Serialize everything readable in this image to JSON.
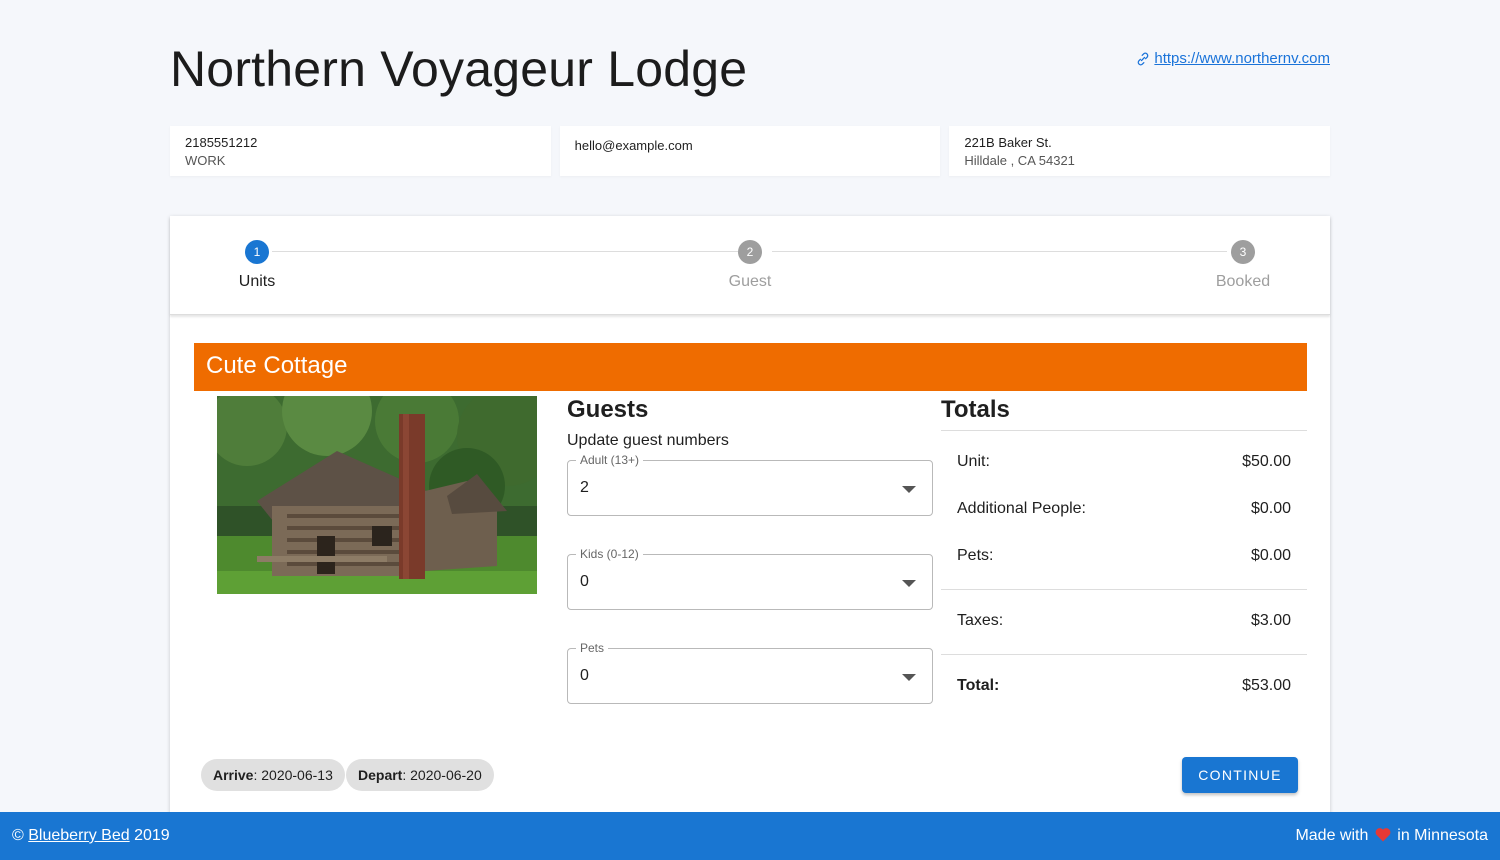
{
  "header": {
    "title": "Northern Voyageur Lodge",
    "website": " https://www.northernv.com"
  },
  "contact": {
    "phone": "2185551212",
    "phone_type": "WORK",
    "email": "hello@example.com",
    "address_line1": "221B Baker St.",
    "address_line2": "Hilldale , CA 54321"
  },
  "stepper": {
    "steps": [
      {
        "number": "1",
        "label": "Units",
        "active": true
      },
      {
        "number": "2",
        "label": "Guest",
        "active": false
      },
      {
        "number": "3",
        "label": "Booked",
        "active": false
      }
    ]
  },
  "unit": {
    "name": "Cute Cottage",
    "header_color": "#ef6c00"
  },
  "guests": {
    "title": "Guests",
    "subtitle": "Update guest numbers",
    "adult_label": "Adult (13+)",
    "adult_value": "2",
    "kids_label": "Kids (0-12)",
    "kids_value": "0",
    "pets_label": "Pets",
    "pets_value": "0"
  },
  "totals": {
    "title": "Totals",
    "unit_label": "Unit:",
    "unit_value": "$50.00",
    "additional_label": "Additional People:",
    "additional_value": "$0.00",
    "pets_label": "Pets:",
    "pets_value": "$0.00",
    "taxes_label": "Taxes:",
    "taxes_value": "$3.00",
    "total_label": "Total:",
    "total_value": "$53.00"
  },
  "dates": {
    "arrive_label": "Arrive",
    "arrive_value": ": 2020-06-13",
    "depart_label": "Depart",
    "depart_value": ": 2020-06-20"
  },
  "actions": {
    "continue_label": "CONTINUE"
  },
  "footer": {
    "copyright_symbol": "©",
    "brand_link": "Blueberry Bed",
    "year": "2019",
    "made_with": "Made with",
    "location": "in Minnesota"
  },
  "colors": {
    "primary": "#1976d2",
    "accent": "#ef6c00",
    "heart": "#e53935"
  }
}
